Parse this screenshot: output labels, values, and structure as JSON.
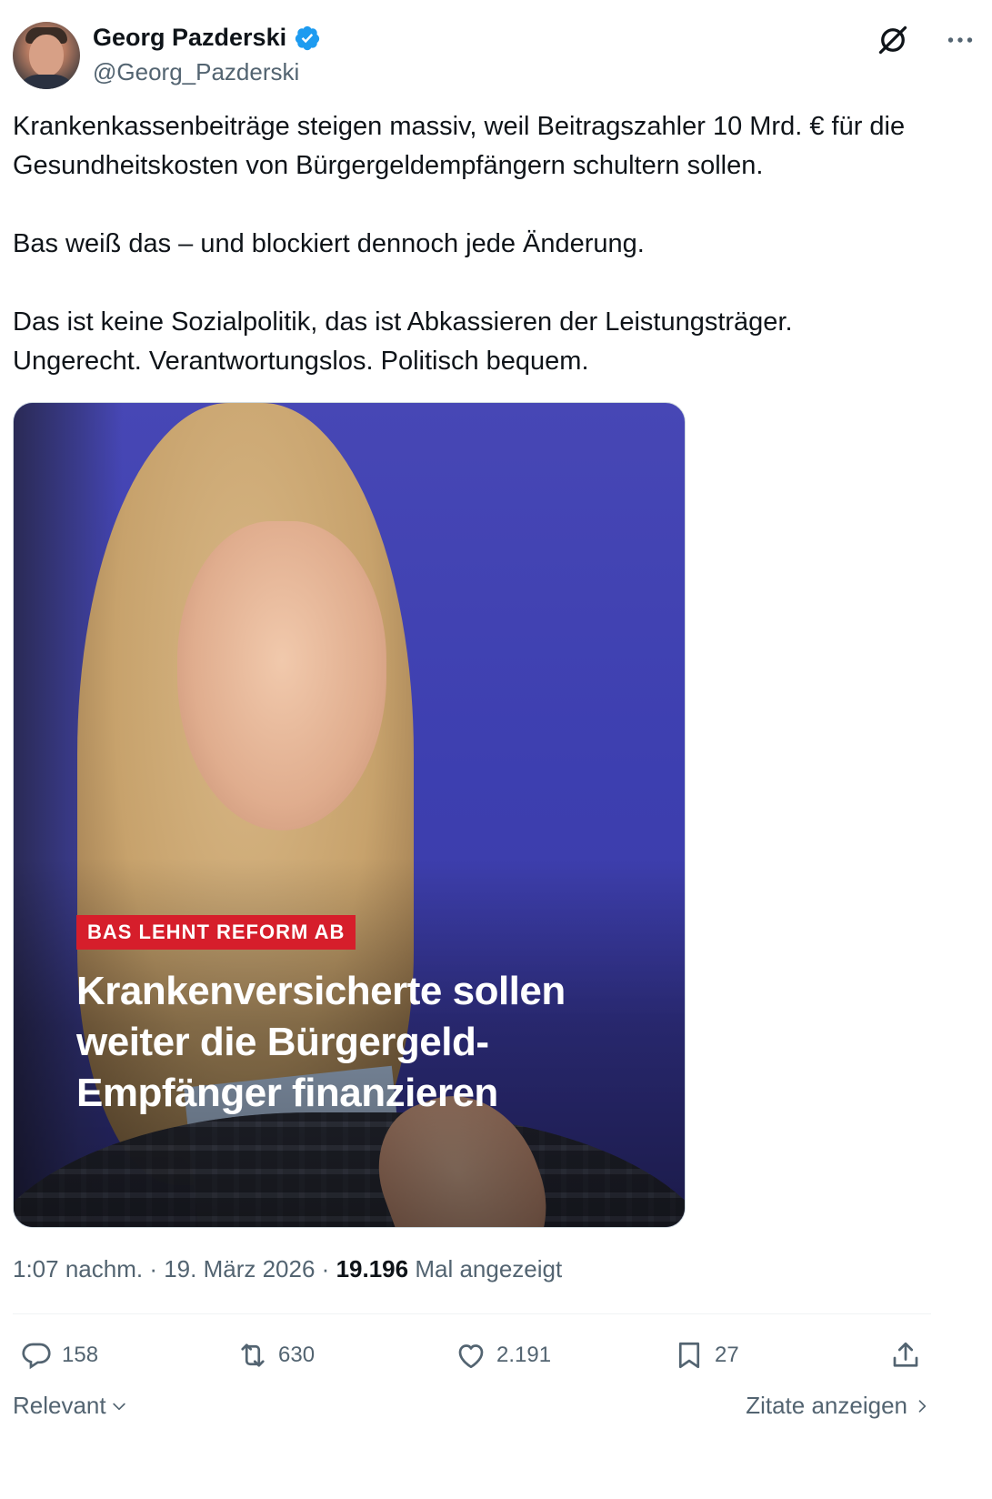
{
  "author": {
    "name": "Georg Pazderski",
    "handle": "@Georg_Pazderski",
    "verified_icon": "verified-badge-icon"
  },
  "tweet": {
    "paragraphs": [
      "Krankenkassenbeiträge steigen massiv, weil Beitragszahler 10 Mrd. € für die Gesundheitskosten von Bürgergeldempfängern schultern sollen.",
      "Bas weiß das – und blockiert dennoch jede Änderung.",
      "Das ist keine Sozialpolitik, das ist Abkassieren der Leistungsträger.\nUngerecht. Verantwortungslos. Politisch bequem."
    ]
  },
  "media": {
    "badge": "BAS LEHNT REFORM AB",
    "headline": "Krankenversicherte sollen weiter die Bürgergeld-Empfänger finanzieren"
  },
  "meta": {
    "time": "1:07 nachm.",
    "date": "19. März 2026",
    "views_count": "19.196",
    "views_label": "Mal angezeigt"
  },
  "actions": {
    "replies": "158",
    "reposts": "630",
    "likes": "2.191",
    "bookmarks": "27"
  },
  "footer": {
    "sort_label": "Relevant",
    "quotes_label": "Zitate anzeigen"
  },
  "colors": {
    "text_primary": "#0f1419",
    "text_secondary": "#536471",
    "verified_blue": "#1d9bf0",
    "badge_red": "#d61e2b"
  }
}
